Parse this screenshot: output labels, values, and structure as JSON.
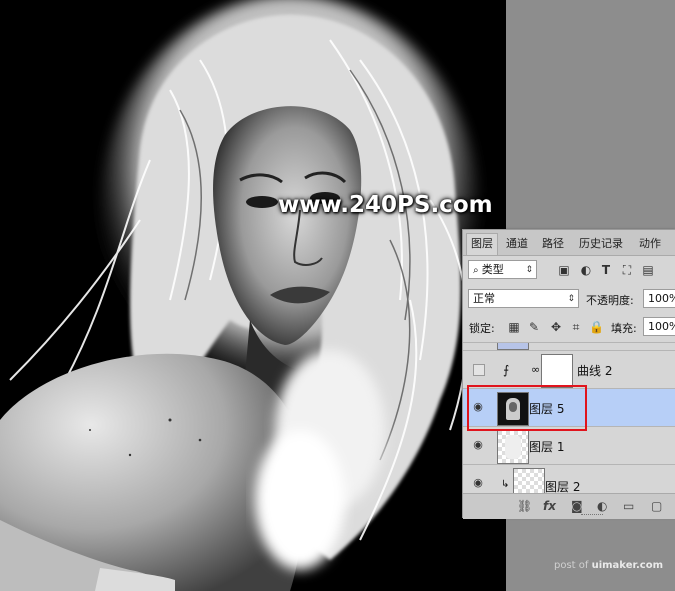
{
  "watermark": "www.240PS.com",
  "credit": {
    "prefix": "post of ",
    "site": "uimaker.com"
  },
  "layers_panel": {
    "tabs": [
      {
        "label": "图层",
        "active": true
      },
      {
        "label": "通道",
        "active": false
      },
      {
        "label": "路径",
        "active": false
      },
      {
        "label": "历史记录",
        "active": false
      },
      {
        "label": "动作",
        "active": false
      }
    ],
    "filter": {
      "value": "类型",
      "icon": "search-icon"
    },
    "blend_mode": "正常",
    "opacity_label": "不透明度:",
    "opacity_value": "100%",
    "lock_label": "锁定:",
    "fill_label": "填充:",
    "fill_value": "100%",
    "layers": [
      {
        "name": "曲线 2",
        "visible": false,
        "selected": false,
        "type": "adjustment"
      },
      {
        "name": "图层 5",
        "visible": true,
        "selected": true,
        "type": "image"
      },
      {
        "name": "图层 1",
        "visible": true,
        "selected": false,
        "type": "transparent"
      },
      {
        "name": "图层 2",
        "visible": true,
        "selected": false,
        "type": "clipped"
      }
    ]
  },
  "colors": {
    "highlight": "#e0141d",
    "selected_row": "#b7cff7"
  }
}
